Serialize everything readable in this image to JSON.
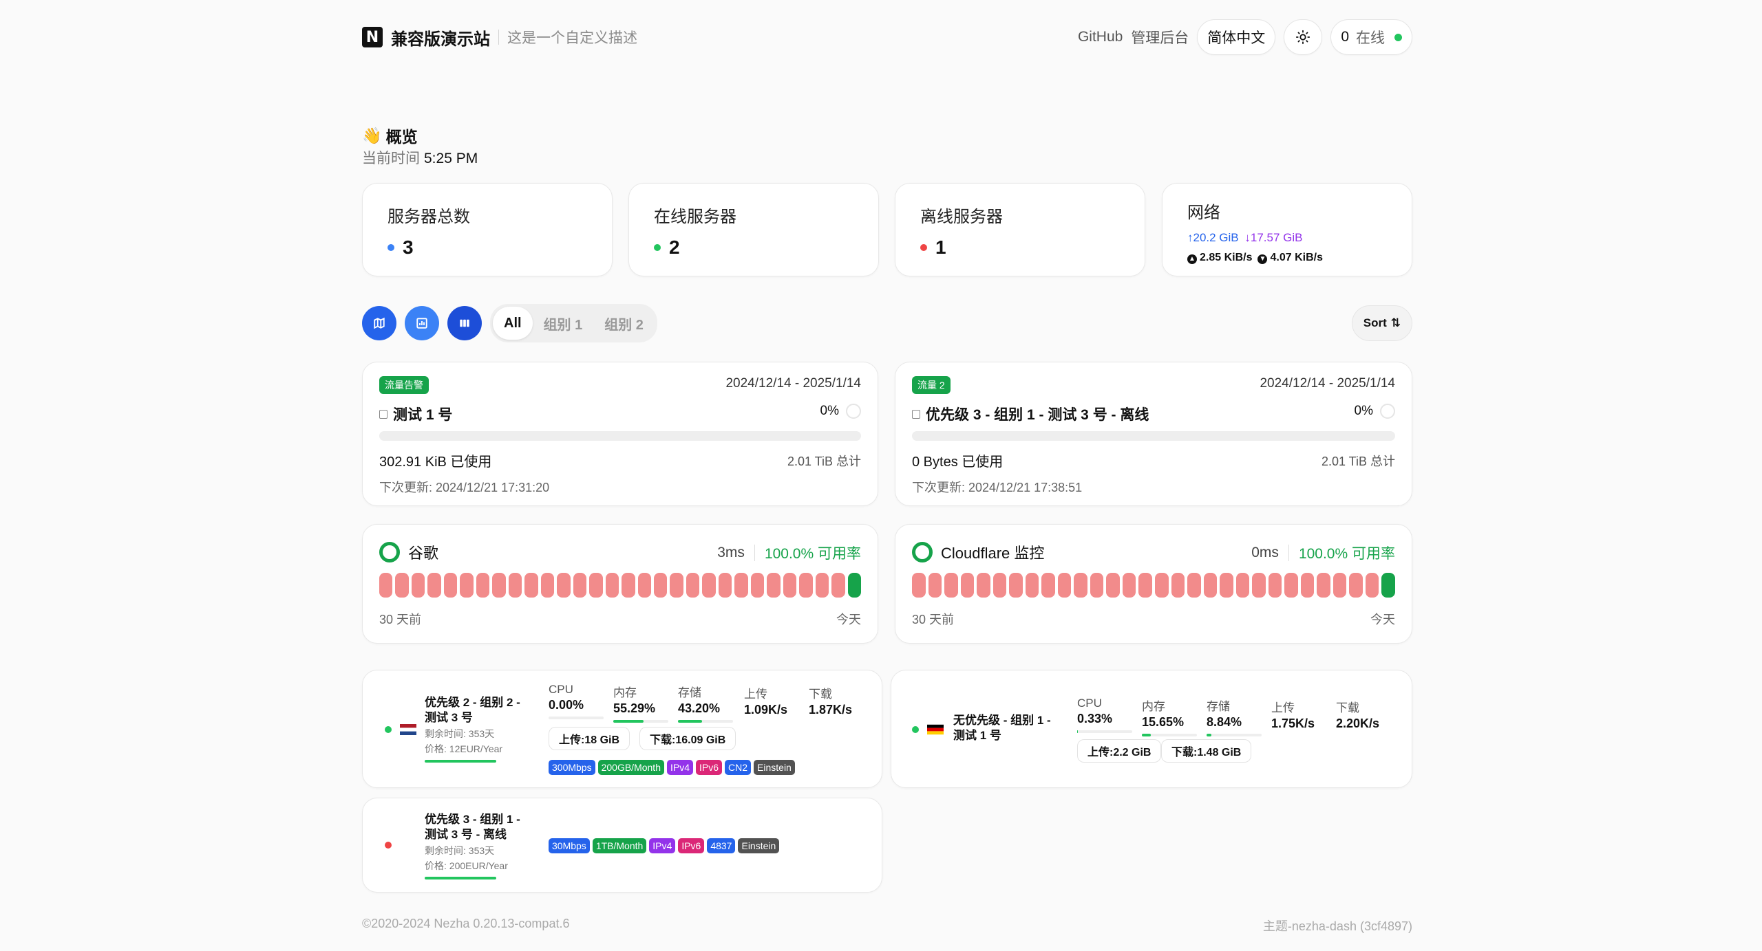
{
  "header": {
    "logo_letter": "N",
    "site_name": "兼容版演示站",
    "site_desc": "这是一个自定义描述",
    "github_label": "GitHub",
    "admin_label": "管理后台",
    "language_label": "简体中文",
    "online_count": "0",
    "online_label": "在线"
  },
  "overview": {
    "wave_emoji": "👋",
    "title": "概览",
    "time_label": "当前时间",
    "time_value": "5:25 PM"
  },
  "stats": {
    "total_label": "服务器总数",
    "total_value": "3",
    "online_label": "在线服务器",
    "online_value": "2",
    "offline_label": "离线服务器",
    "offline_value": "1",
    "network_label": "网络",
    "net_upload_total": "↑20.2 GiB",
    "net_download_total": "↓17.57 GiB",
    "net_upload_speed": "2.85 KiB/s",
    "net_download_speed": "4.07 KiB/s"
  },
  "toolbar": {
    "tabs": [
      "All",
      "组别 1",
      "组别 2"
    ],
    "active_tab": 0,
    "sort_label": "Sort",
    "sort_icon": "⇅"
  },
  "traffic_cards": [
    {
      "badge": "流量告警",
      "range": "2024/12/14 - 2025/1/14",
      "name": "测试 1 号",
      "percent": "0%",
      "usage_fraction": 0,
      "used": "302.91 KiB 已使用",
      "total": "2.01 TiB 总计",
      "next_update": "下次更新: 2024/12/21 17:31:20"
    },
    {
      "badge": "流量 2",
      "range": "2024/12/14 - 2025/1/14",
      "name": "优先级 3 - 组别 1 - 测试 3 号 - 离线",
      "percent": "0%",
      "usage_fraction": 0,
      "used": "0 Bytes 已使用",
      "total": "2.01 TiB 总计",
      "next_update": "下次更新: 2024/12/21 17:38:51"
    }
  ],
  "monitors": [
    {
      "name": "谷歌",
      "latency": "3ms",
      "availability": "100.0% 可用率",
      "days_ago": "30 天前",
      "today": "今天",
      "bars_down": 29,
      "bars_up": 1
    },
    {
      "name": "Cloudflare 监控",
      "latency": "0ms",
      "availability": "100.0% 可用率",
      "days_ago": "30 天前",
      "today": "今天",
      "bars_down": 29,
      "bars_up": 1
    }
  ],
  "servers": [
    {
      "name_line1": "优先级 2 - 组别 2 -",
      "name_line2": "测试 3 号",
      "remaining": "剩余时间: 353天",
      "price": "价格: 12EUR/Year",
      "flag": "NL",
      "metrics": [
        {
          "label": "CPU",
          "value": "0.00%",
          "fraction": 0.0
        },
        {
          "label": "内存",
          "value": "55.29%",
          "fraction": 0.5529
        },
        {
          "label": "存储",
          "value": "43.20%",
          "fraction": 0.432
        },
        {
          "label": "上传",
          "value": "1.09K/s"
        },
        {
          "label": "下载",
          "value": "1.87K/s"
        }
      ],
      "upload_total": "上传:18 GiB",
      "download_total": "下载:16.09 GiB",
      "tags": [
        {
          "text": "300Mbps",
          "color": "#2563eb"
        },
        {
          "text": "200GB/Month",
          "color": "#16a34a"
        },
        {
          "text": "IPv4",
          "color": "#9333ea"
        },
        {
          "text": "IPv6",
          "color": "#db2777"
        },
        {
          "text": "CN2",
          "color": "#2563eb"
        },
        {
          "text": "Einstein",
          "color": "#525252"
        }
      ],
      "status_color": "#22c55e"
    },
    {
      "name_line1": "无优先级 - 组别 1 -",
      "name_line2": "测试 1 号",
      "flag": "DE",
      "metrics": [
        {
          "label": "CPU",
          "value": "0.33%",
          "fraction": 0.0033
        },
        {
          "label": "内存",
          "value": "15.65%",
          "fraction": 0.1565
        },
        {
          "label": "存储",
          "value": "8.84%",
          "fraction": 0.0884
        },
        {
          "label": "上传",
          "value": "1.75K/s"
        },
        {
          "label": "下载",
          "value": "2.20K/s"
        }
      ],
      "upload_total": "上传:2.2 GiB",
      "download_total": "下载:1.48 GiB",
      "status_color": "#22c55e"
    },
    {
      "name_line1": "优先级 3 - 组别 1 -",
      "name_line2": "测试 3 号 - 离线",
      "remaining": "剩余时间: 353天",
      "price": "价格: 200EUR/Year",
      "tags": [
        {
          "text": "30Mbps",
          "color": "#2563eb"
        },
        {
          "text": "1TB/Month",
          "color": "#16a34a"
        },
        {
          "text": "IPv4",
          "color": "#9333ea"
        },
        {
          "text": "IPv6",
          "color": "#db2777"
        },
        {
          "text": "4837",
          "color": "#2563eb"
        },
        {
          "text": "Einstein",
          "color": "#525252"
        }
      ],
      "status_color": "#ef4444"
    }
  ],
  "footer": {
    "copyright": "©2020-2024 Nezha 0.20.13-compat.6",
    "theme": "主题-nezha-dash (3cf4897)"
  },
  "colors": {
    "accent_blue": "#2563eb",
    "online_green": "#22c55e",
    "offline_red": "#ef4444",
    "upload_blue": "#2563eb",
    "download_purple": "#9333ea"
  }
}
